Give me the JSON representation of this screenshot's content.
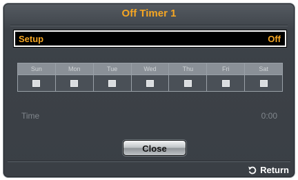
{
  "dialog": {
    "title": "Off Timer 1"
  },
  "setup": {
    "label": "Setup",
    "value": "Off"
  },
  "days": [
    {
      "name": "Sun",
      "checked": false
    },
    {
      "name": "Mon",
      "checked": false
    },
    {
      "name": "Tue",
      "checked": false
    },
    {
      "name": "Wed",
      "checked": false
    },
    {
      "name": "Thu",
      "checked": false
    },
    {
      "name": "Fri",
      "checked": false
    },
    {
      "name": "Sat",
      "checked": false
    }
  ],
  "time": {
    "label": "Time",
    "value": "0:00"
  },
  "buttons": {
    "close_label": "Close",
    "return_label": "Return",
    "return_icon": "return-arrow-icon"
  },
  "colors": {
    "accent": "#f5a623",
    "dialog_bg": "#3d4248",
    "disabled_text": "#80868c"
  }
}
